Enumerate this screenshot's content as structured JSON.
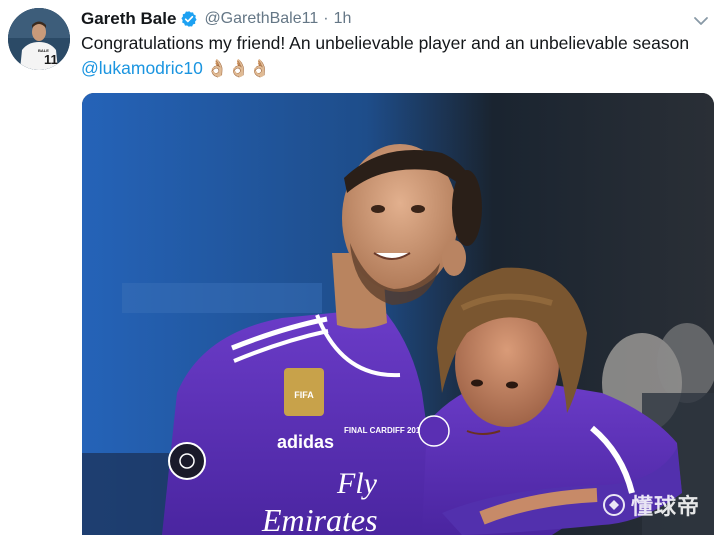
{
  "tweet": {
    "author_name": "Gareth Bale",
    "handle": "@GarethBale11",
    "separator": "·",
    "time": "1h",
    "verified": true,
    "text": "Congratulations my friend! An unbelievable player and an unbelievable season",
    "mention": "@lukamodric10",
    "emojis": "👌🏼👌🏼👌🏼",
    "avatar_jersey_number": "11",
    "avatar_jersey_name": "BALE",
    "verified_color": "#1da1f2",
    "link_color": "#1b95e0"
  },
  "media": {
    "jersey_sponsor_line1": "Fly",
    "jersey_sponsor_line2": "Emirates",
    "jersey_brand": "adidas",
    "jersey_badge": "FIFA",
    "jersey_patch": "FINAL CARDIFF 2017",
    "kit_color": "#5a2fb3",
    "watermark_text": "懂球帝"
  }
}
